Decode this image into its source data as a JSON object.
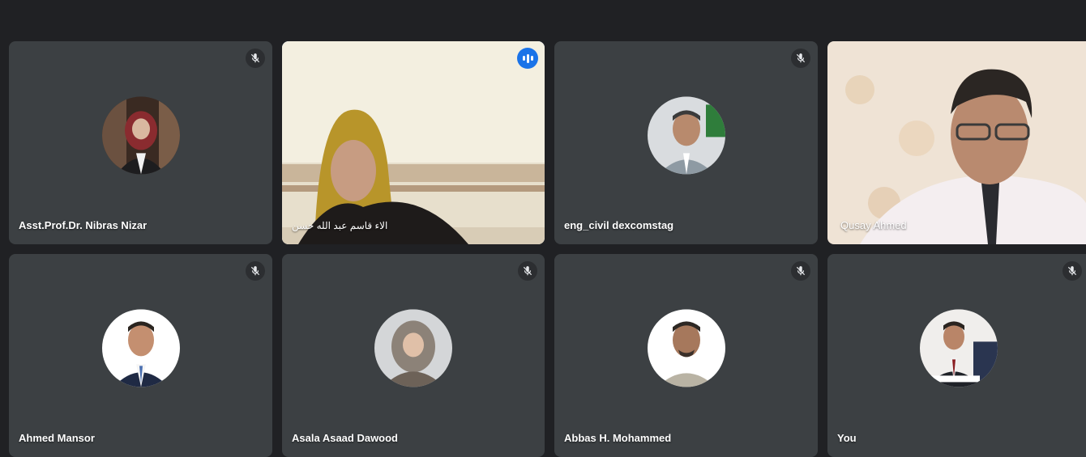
{
  "participants": [
    {
      "name": "Asst.Prof.Dr. Nibras Nizar"
    },
    {
      "name": "الاء قاسم عبد الله حسن"
    },
    {
      "name": "eng_civil dexcomstag"
    },
    {
      "name": "Qusay Ahmed"
    },
    {
      "name": "Ahmed Mansor"
    },
    {
      "name": "Asala Asaad Dawood"
    },
    {
      "name": "Abbas H. Mohammed"
    },
    {
      "name": "You"
    }
  ],
  "colors": {
    "background": "#202124",
    "tile": "#3c4043",
    "speaking_border": "#6c9de9",
    "speaking_badge": "#1a73e8"
  },
  "icons": {
    "muted": "mic-off-icon",
    "speaking": "audio-level-icon"
  }
}
